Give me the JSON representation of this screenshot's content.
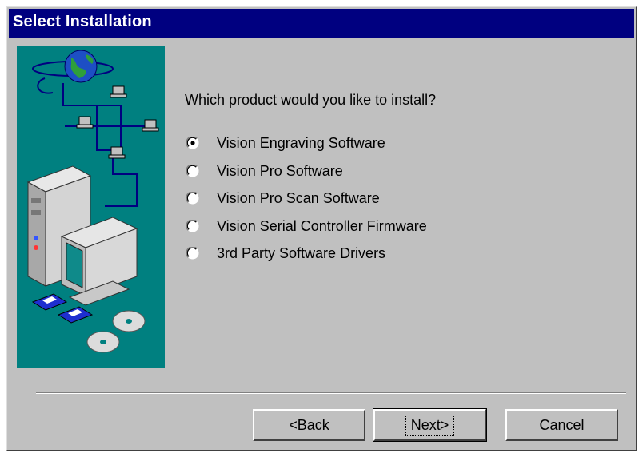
{
  "window": {
    "title": "Select Installation"
  },
  "dialog": {
    "prompt": "Which product would you like to install?",
    "selected_index": 0,
    "options": [
      "Vision Engraving Software",
      "Vision Pro Software",
      "Vision Pro Scan Software",
      "Vision Serial Controller Firmware",
      "3rd Party Software Drivers"
    ]
  },
  "buttons": {
    "back_mnemonic": "B",
    "back_rest": "ack",
    "back_prefix": "<",
    "next_text": "Next",
    "next_suffix": ">",
    "cancel": "Cancel"
  },
  "colors": {
    "titlebar": "#000080",
    "face": "#c0c0c0",
    "art_bg": "#008080"
  }
}
